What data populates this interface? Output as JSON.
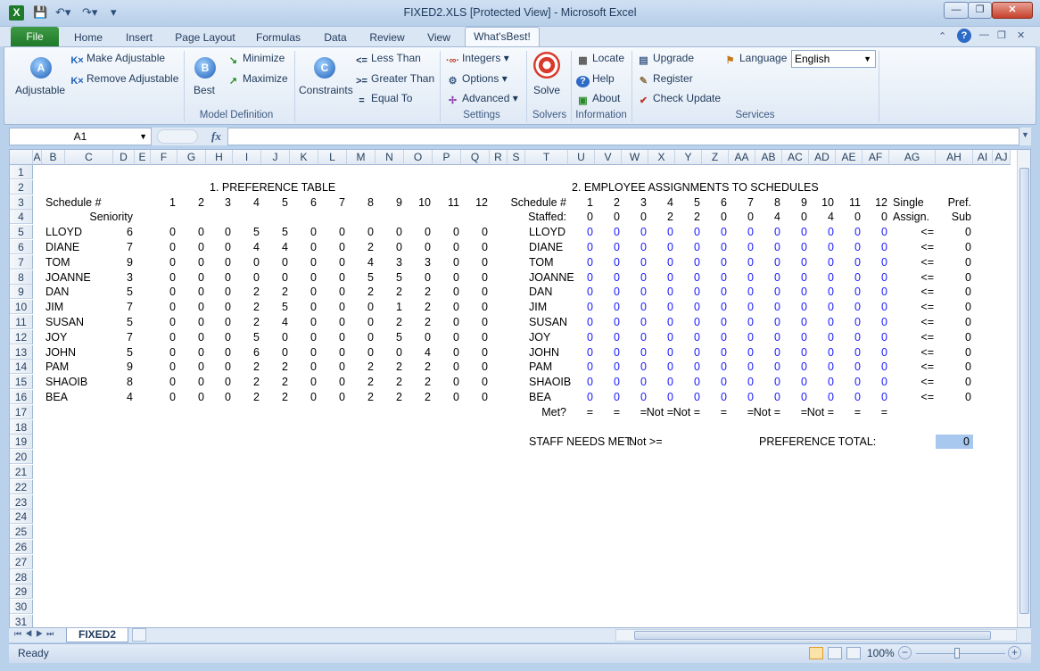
{
  "window": {
    "title": "FIXED2.XLS  [Protected View]  -  Microsoft Excel",
    "minimize": "—",
    "restore": "❐",
    "close": "✕"
  },
  "tabs": [
    "File",
    "Home",
    "Insert",
    "Page Layout",
    "Formulas",
    "Data",
    "Review",
    "View",
    "What'sBest!"
  ],
  "ribbon": {
    "adjustable": "Adjustable",
    "make_adjustable": "Make Adjustable",
    "remove_adjustable": "Remove Adjustable",
    "best": "Best",
    "minimize": "Minimize",
    "maximize": "Maximize",
    "constraints": "Constraints",
    "less_than": "Less Than",
    "greater_than": "Greater Than",
    "equal_to": "Equal To",
    "integers": "Integers",
    "options": "Options",
    "advanced": "Advanced",
    "solve": "Solve",
    "locate": "Locate",
    "help": "Help",
    "about": "About",
    "upgrade": "Upgrade",
    "register": "Register",
    "check_update": "Check Update",
    "language": "Language",
    "language_value": "English",
    "groups": {
      "model_definition": "Model Definition",
      "settings": "Settings",
      "solvers": "Solvers",
      "information": "Information",
      "services": "Services"
    }
  },
  "formula_bar": {
    "name_box": "A1",
    "fx": "fx",
    "value": ""
  },
  "columns": [
    "A",
    "B",
    "C",
    "D",
    "E",
    "F",
    "G",
    "H",
    "I",
    "J",
    "K",
    "L",
    "M",
    "N",
    "O",
    "P",
    "Q",
    "R",
    "S",
    "T",
    "U",
    "V",
    "W",
    "X",
    "Y",
    "Z",
    "AA",
    "AB",
    "AC",
    "AD",
    "AE",
    "AF",
    "AG",
    "AH",
    "AI",
    "AJ"
  ],
  "sheet": {
    "pref_title": "1. PREFERENCE TABLE",
    "assign_title": "2. EMPLOYEE ASSIGNMENTS TO SCHEDULES",
    "schedule_label": "Schedule #",
    "seniority_label": "Seniority",
    "staffed_label": "Staffed:",
    "single_label": "Single",
    "assign_label": "Assign.",
    "pref_label": "Pref.",
    "sub_label": "Sub",
    "schedule_numbers": [
      "1",
      "2",
      "3",
      "4",
      "5",
      "6",
      "7",
      "8",
      "9",
      "10",
      "11",
      "12"
    ],
    "staffed": [
      "0",
      "0",
      "0",
      "2",
      "2",
      "0",
      "0",
      "4",
      "0",
      "4",
      "0",
      "0"
    ],
    "employees": [
      {
        "name": "LLOYD",
        "seniority": "6",
        "prefs": [
          "0",
          "0",
          "0",
          "5",
          "5",
          "0",
          "0",
          "0",
          "0",
          "0",
          "0",
          "0"
        ],
        "assign": [
          "0",
          "0",
          "0",
          "0",
          "0",
          "0",
          "0",
          "0",
          "0",
          "0",
          "0",
          "0"
        ],
        "rel": "<=",
        "sub": "0"
      },
      {
        "name": "DIANE",
        "seniority": "7",
        "prefs": [
          "0",
          "0",
          "0",
          "4",
          "4",
          "0",
          "0",
          "2",
          "0",
          "0",
          "0",
          "0"
        ],
        "assign": [
          "0",
          "0",
          "0",
          "0",
          "0",
          "0",
          "0",
          "0",
          "0",
          "0",
          "0",
          "0"
        ],
        "rel": "<=",
        "sub": "0"
      },
      {
        "name": "TOM",
        "seniority": "9",
        "prefs": [
          "0",
          "0",
          "0",
          "0",
          "0",
          "0",
          "0",
          "4",
          "3",
          "3",
          "0",
          "0"
        ],
        "assign": [
          "0",
          "0",
          "0",
          "0",
          "0",
          "0",
          "0",
          "0",
          "0",
          "0",
          "0",
          "0"
        ],
        "rel": "<=",
        "sub": "0"
      },
      {
        "name": "JOANNE",
        "seniority": "3",
        "prefs": [
          "0",
          "0",
          "0",
          "0",
          "0",
          "0",
          "0",
          "5",
          "5",
          "0",
          "0",
          "0"
        ],
        "assign": [
          "0",
          "0",
          "0",
          "0",
          "0",
          "0",
          "0",
          "0",
          "0",
          "0",
          "0",
          "0"
        ],
        "rel": "<=",
        "sub": "0"
      },
      {
        "name": "DAN",
        "seniority": "5",
        "prefs": [
          "0",
          "0",
          "0",
          "2",
          "2",
          "0",
          "0",
          "2",
          "2",
          "2",
          "0",
          "0"
        ],
        "assign": [
          "0",
          "0",
          "0",
          "0",
          "0",
          "0",
          "0",
          "0",
          "0",
          "0",
          "0",
          "0"
        ],
        "rel": "<=",
        "sub": "0"
      },
      {
        "name": "JIM",
        "seniority": "7",
        "prefs": [
          "0",
          "0",
          "0",
          "2",
          "5",
          "0",
          "0",
          "0",
          "1",
          "2",
          "0",
          "0"
        ],
        "assign": [
          "0",
          "0",
          "0",
          "0",
          "0",
          "0",
          "0",
          "0",
          "0",
          "0",
          "0",
          "0"
        ],
        "rel": "<=",
        "sub": "0"
      },
      {
        "name": "SUSAN",
        "seniority": "5",
        "prefs": [
          "0",
          "0",
          "0",
          "2",
          "4",
          "0",
          "0",
          "0",
          "2",
          "2",
          "0",
          "0"
        ],
        "assign": [
          "0",
          "0",
          "0",
          "0",
          "0",
          "0",
          "0",
          "0",
          "0",
          "0",
          "0",
          "0"
        ],
        "rel": "<=",
        "sub": "0"
      },
      {
        "name": "JOY",
        "seniority": "7",
        "prefs": [
          "0",
          "0",
          "0",
          "5",
          "0",
          "0",
          "0",
          "0",
          "5",
          "0",
          "0",
          "0"
        ],
        "assign": [
          "0",
          "0",
          "0",
          "0",
          "0",
          "0",
          "0",
          "0",
          "0",
          "0",
          "0",
          "0"
        ],
        "rel": "<=",
        "sub": "0"
      },
      {
        "name": "JOHN",
        "seniority": "5",
        "prefs": [
          "0",
          "0",
          "0",
          "6",
          "0",
          "0",
          "0",
          "0",
          "0",
          "4",
          "0",
          "0"
        ],
        "assign": [
          "0",
          "0",
          "0",
          "0",
          "0",
          "0",
          "0",
          "0",
          "0",
          "0",
          "0",
          "0"
        ],
        "rel": "<=",
        "sub": "0"
      },
      {
        "name": "PAM",
        "seniority": "9",
        "prefs": [
          "0",
          "0",
          "0",
          "2",
          "2",
          "0",
          "0",
          "2",
          "2",
          "2",
          "0",
          "0"
        ],
        "assign": [
          "0",
          "0",
          "0",
          "0",
          "0",
          "0",
          "0",
          "0",
          "0",
          "0",
          "0",
          "0"
        ],
        "rel": "<=",
        "sub": "0"
      },
      {
        "name": "SHAOIB",
        "seniority": "8",
        "prefs": [
          "0",
          "0",
          "0",
          "2",
          "2",
          "0",
          "0",
          "2",
          "2",
          "2",
          "0",
          "0"
        ],
        "assign": [
          "0",
          "0",
          "0",
          "0",
          "0",
          "0",
          "0",
          "0",
          "0",
          "0",
          "0",
          "0"
        ],
        "rel": "<=",
        "sub": "0"
      },
      {
        "name": "BEA",
        "seniority": "4",
        "prefs": [
          "0",
          "0",
          "0",
          "2",
          "2",
          "0",
          "0",
          "2",
          "2",
          "2",
          "0",
          "0"
        ],
        "assign": [
          "0",
          "0",
          "0",
          "0",
          "0",
          "0",
          "0",
          "0",
          "0",
          "0",
          "0",
          "0"
        ],
        "rel": "<=",
        "sub": "0"
      }
    ],
    "met_label": "Met?",
    "met": [
      "=",
      "=",
      "=",
      "Not =",
      "Not =",
      "=",
      "=",
      "Not =",
      "=",
      "Not =",
      "=",
      "="
    ],
    "staff_needs_label": "STAFF NEEDS MET:",
    "staff_needs_value": "Not >=",
    "pref_total_label": "PREFERENCE TOTAL:",
    "pref_total_value": "0"
  },
  "sheet_tab": "FIXED2",
  "status": {
    "ready": "Ready",
    "zoom": "100%"
  },
  "colors": {
    "accent_green": "#1f7a2a",
    "selected_cell": "#a9c8f0",
    "blue_values": "#1a1aff"
  }
}
